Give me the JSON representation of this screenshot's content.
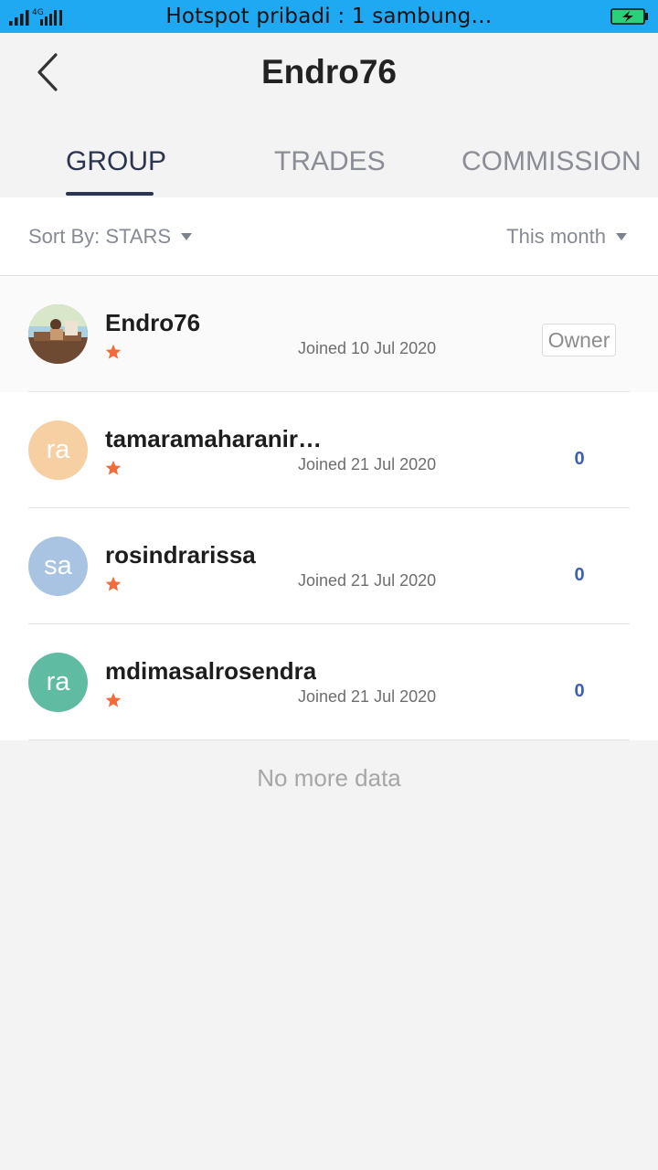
{
  "status_bar": {
    "network_label": "4G",
    "text": "Hotspot pribadi : 1 sambung…"
  },
  "header": {
    "title": "Endro76"
  },
  "tabs": [
    {
      "label": "GROUP",
      "active": true
    },
    {
      "label": "TRADES",
      "active": false
    },
    {
      "label": "COMMISSION",
      "active": false
    }
  ],
  "filters": {
    "sort": "Sort By: STARS",
    "period": "This month"
  },
  "members": [
    {
      "name": "Endro76",
      "avatar_text": "",
      "avatar_color": "#7b5a45",
      "joined": "Joined 10 Jul 2020",
      "badge": "Owner",
      "count": ""
    },
    {
      "name": "tamaramaharanir…",
      "avatar_text": "ra",
      "avatar_color": "#f6cfa3",
      "joined": "Joined 21 Jul 2020",
      "badge": "",
      "count": "0"
    },
    {
      "name": "rosindrarissa",
      "avatar_text": "sa",
      "avatar_color": "#a9c4e3",
      "joined": "Joined 21 Jul 2020",
      "badge": "",
      "count": "0"
    },
    {
      "name": "mdimasalrosendra",
      "avatar_text": "ra",
      "avatar_color": "#5fbba2",
      "joined": "Joined 21 Jul 2020",
      "badge": "",
      "count": "0"
    }
  ],
  "footer": {
    "no_more": "No more data"
  },
  "colors": {
    "status_bar": "#1fa9f2",
    "active_tab": "#2c3550",
    "star": "#f26b3a",
    "count": "#3f5fb4"
  }
}
